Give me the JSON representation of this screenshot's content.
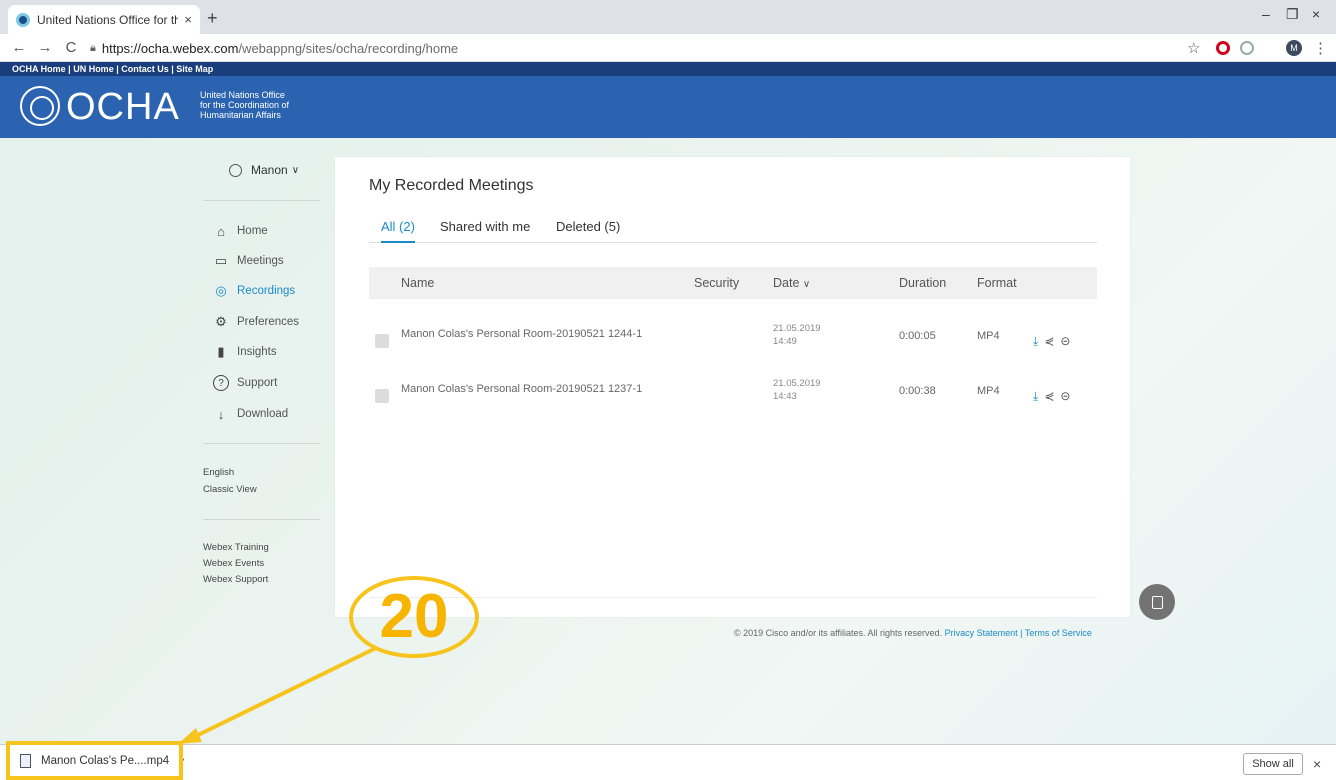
{
  "browser": {
    "tab_title": "United Nations Office for the Coo",
    "new_tab": "+",
    "tab_close": "×",
    "url_host": "https://ocha.webex.com",
    "url_path": "/webappng/sites/ocha/recording/home",
    "nav_back": "←",
    "nav_forward": "→",
    "nav_reload": "C",
    "win_minimize": "–",
    "win_restore": "❐",
    "win_close": "×",
    "bookmark_star": "☆",
    "profile_initial": "M",
    "menu": "⋮"
  },
  "ocha": {
    "topnav": "OCHA Home | UN Home | Contact Us | Site Map",
    "brand": "OCHA",
    "brand_sub_1": "United Nations Office",
    "brand_sub_2": "for the Coordination of",
    "brand_sub_3": "Humanitarian Affairs"
  },
  "sidebar": {
    "user": "Manon",
    "items": [
      {
        "label": "Home",
        "icon": "⌂"
      },
      {
        "label": "Meetings",
        "icon": "▭"
      },
      {
        "label": "Recordings",
        "icon": "◎"
      },
      {
        "label": "Preferences",
        "icon": "⚙"
      },
      {
        "label": "Insights",
        "icon": "▮"
      },
      {
        "label": "Support",
        "icon": "?"
      },
      {
        "label": "Download",
        "icon": "↓"
      }
    ],
    "lang": "English",
    "classic": "Classic View",
    "links": [
      "Webex Training",
      "Webex Events",
      "Webex Support"
    ]
  },
  "main": {
    "title": "My Recorded Meetings",
    "tabs": [
      "All (2)",
      "Shared with me",
      "Deleted (5)"
    ],
    "columns": {
      "name": "Name",
      "security": "Security",
      "date": "Date",
      "duration": "Duration",
      "format": "Format"
    },
    "rows": [
      {
        "name": "Manon Colas's Personal Room-20190521 1244-1",
        "date": "21.05.2019",
        "time": "14:49",
        "duration": "0:00:05",
        "format": "MP4"
      },
      {
        "name": "Manon Colas's Personal Room-20190521 1237-1",
        "date": "21.05.2019",
        "time": "14:43",
        "duration": "0:00:38",
        "format": "MP4"
      }
    ]
  },
  "footer": {
    "copyright": "© 2019 Cisco and/or its affiliates. All rights reserved.",
    "privacy": "Privacy Statement",
    "sep": "|",
    "terms": "Terms of Service"
  },
  "annotation": {
    "number": "20",
    "color": "#f7c31d"
  },
  "shelf": {
    "file": "Manon Colas's Pe....mp4",
    "chevron": "^",
    "show_all": "Show all",
    "close": "×"
  },
  "colors": {
    "accent": "#1a8bc8",
    "header_blue": "#2b63b1",
    "annotation": "#f7c31d"
  }
}
